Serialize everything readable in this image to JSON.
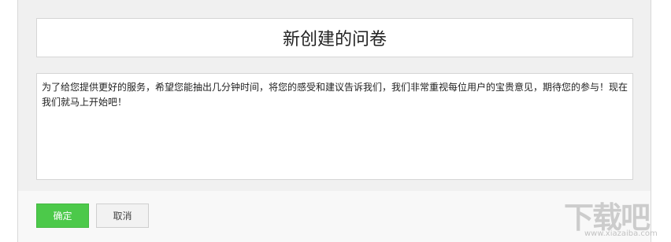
{
  "survey": {
    "title": "新创建的问卷",
    "intro": "为了给您提供更好的服务，希望您能抽出几分钟时间，将您的感受和建议告诉我们，我们非常重视每位用户的宝贵意见，期待您的参与！现在我们就马上开始吧！"
  },
  "footer": {
    "confirm_label": "确定",
    "cancel_label": "取消"
  },
  "watermark": {
    "main": "下载吧",
    "sub": "www.xiazaiba.com"
  },
  "colors": {
    "confirm_bg": "#4cc94a",
    "panel_bg": "#f0f0f0",
    "footer_bg": "#f8f8f8"
  }
}
